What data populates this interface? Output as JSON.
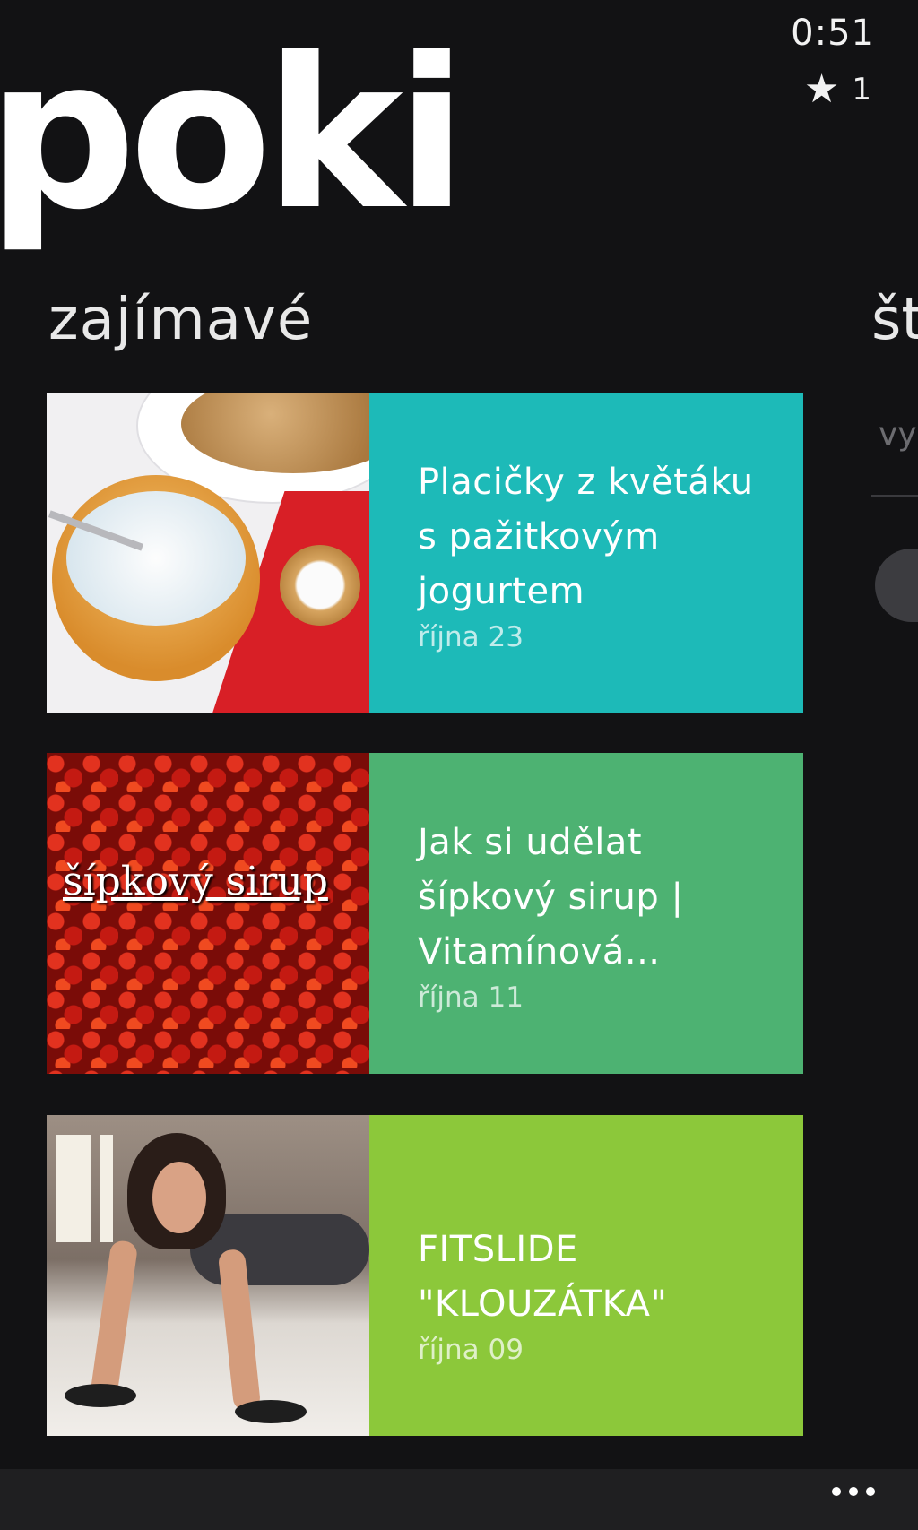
{
  "status_bar": {
    "time": "0:51",
    "rating_icon": "star-icon",
    "rating_count": "1"
  },
  "app": {
    "title": "poki"
  },
  "sections": {
    "current": "zajímavé",
    "next_partial": "št",
    "next_field_partial": "vy"
  },
  "articles": [
    {
      "title": "Placičky z květáku s pažitkovým jogurtem",
      "date": "října 23",
      "color": "#1DBAB8"
    },
    {
      "title": "Jak si udělat šípkový sirup | Vitamínová...",
      "date": "října 11",
      "color": "#4DB272",
      "thumb_text": "šípkový sirup"
    },
    {
      "title": "FITSLIDE \"KLOUZÁTKA\"",
      "date": "října 09",
      "color": "#8CC83A"
    }
  ],
  "app_bar": {
    "more_icon": "ellipsis-icon"
  }
}
